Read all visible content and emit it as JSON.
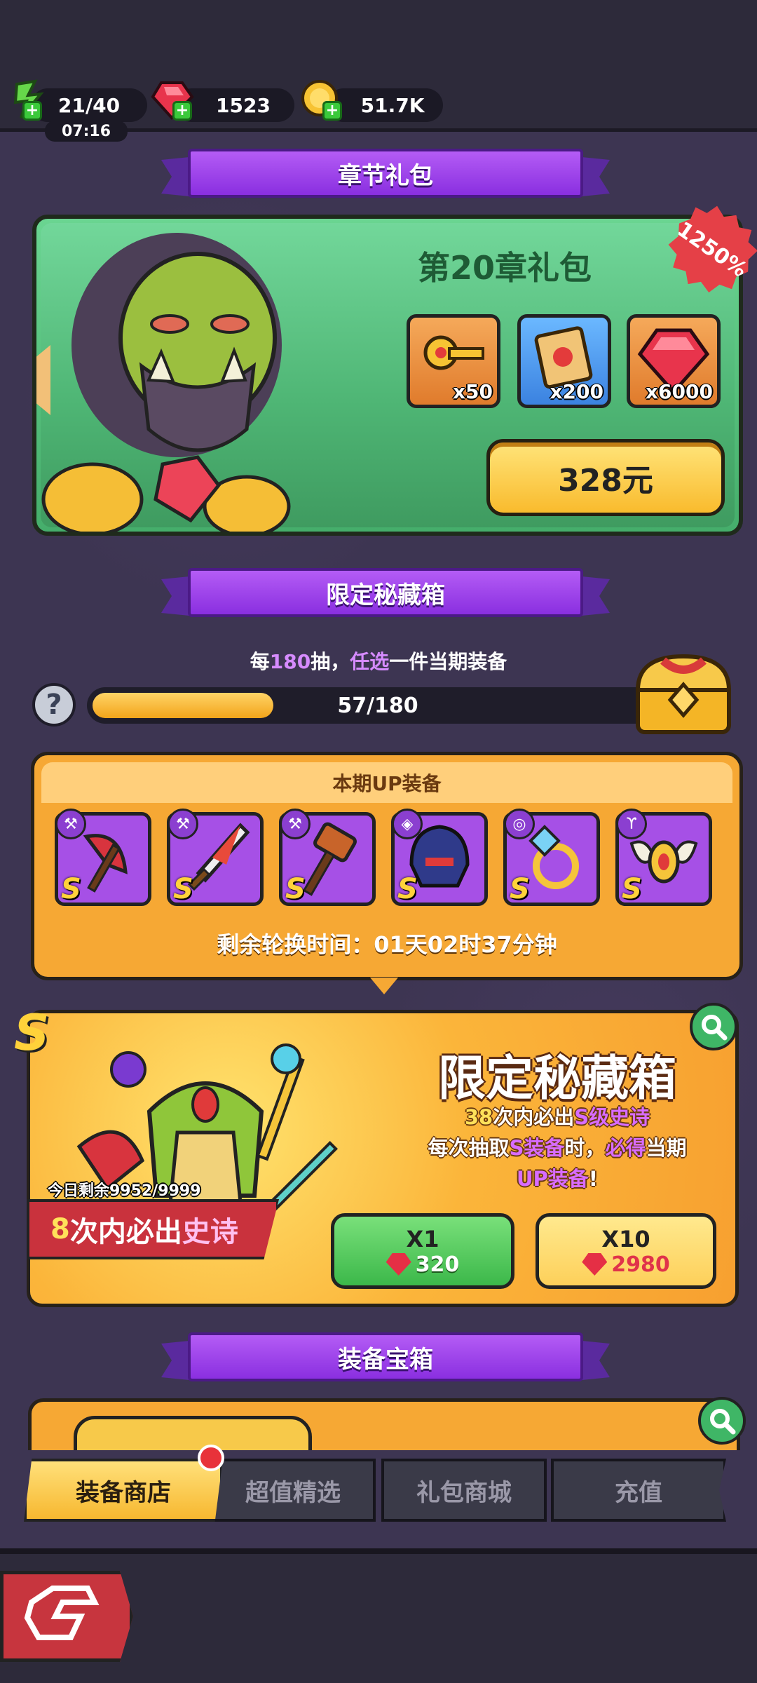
{
  "resources": {
    "energy": "21/40",
    "energy_timer": "07:16",
    "gems": "1523",
    "gold": "51.7K"
  },
  "chapter_pack": {
    "section_title": "章节礼包",
    "title": "第20章礼包",
    "badge": "1250%",
    "items": [
      {
        "icon": "golden-key-icon",
        "count": "x50"
      },
      {
        "icon": "scroll-icon",
        "count": "x200"
      },
      {
        "icon": "ruby-gem-icon",
        "count": "x6000"
      }
    ],
    "price": "328元"
  },
  "limited_chest": {
    "section_title": "限定秘藏箱",
    "desc_prefix": "每",
    "desc_num": "180",
    "desc_mid": "抽，",
    "desc_hl": "任选",
    "desc_suffix": "一件当期装备",
    "progress_text": "57/180",
    "progress_fraction": 0.317,
    "up_header": "本期UP装备",
    "up_items": [
      {
        "grade": "S",
        "icon": "axe-icon"
      },
      {
        "grade": "S",
        "icon": "sword-icon"
      },
      {
        "grade": "S",
        "icon": "hammer-icon"
      },
      {
        "grade": "S",
        "icon": "helmet-icon"
      },
      {
        "grade": "S",
        "icon": "ring-icon"
      },
      {
        "grade": "S",
        "icon": "amulet-icon"
      }
    ],
    "rotation": "剩余轮换时间：01天02时37分钟"
  },
  "gacha": {
    "title": "限定秘藏箱",
    "line1_num": "38",
    "line1_a": "次内必出",
    "line1_b": "S级史诗",
    "line2_a": "每次抽取",
    "line2_b": "S装备",
    "line2_c": "时，",
    "line2_d": "必得",
    "line2_e": "当期",
    "line3": "UP装备",
    "line3_tail": "!",
    "today_remaining": "今日剩余9952/9999",
    "epic_num": "8",
    "epic_text": "次内必出",
    "epic_hl": "史诗",
    "draw1_label": "X1",
    "draw1_cost": "320",
    "draw10_label": "X10",
    "draw10_cost": "2980",
    "grade_label": "S"
  },
  "equip_box": {
    "section_title": "装备宝箱"
  },
  "tabs": [
    {
      "label": "装备商店",
      "active": true
    },
    {
      "label": "超值精选",
      "active": false
    },
    {
      "label": "礼包商城",
      "active": false
    },
    {
      "label": "充值",
      "active": false
    }
  ],
  "colors": {
    "background": "#3d3552",
    "purple_ribbon": "#9b3fe8",
    "green_panel": "#56c27d",
    "orange_panel": "#f6a834",
    "gem_red": "#e52f45"
  }
}
